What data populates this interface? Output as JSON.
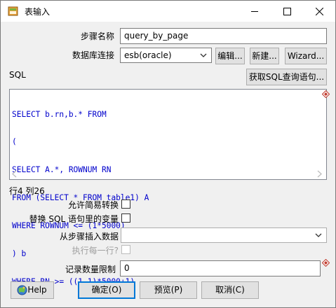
{
  "window": {
    "title": "表输入"
  },
  "form": {
    "step_name_label": "步骤名称",
    "step_name_value": "query_by_page",
    "db_connection_label": "数据库连接",
    "db_connection_value": "esb(oracle)",
    "edit_button": "编辑...",
    "new_button": "新建...",
    "wizard_button": "Wizard...",
    "sql_label": "SQL",
    "get_sql_button": "获取SQL查询语句...",
    "sql_lines": [
      "SELECT b.rn,b.* FROM",
      "(",
      "SELECT A.*, ROWNUM RN",
      "FROM (SELECT * FROM table1) A",
      "WHERE ROWNUM <= (1*5000)",
      ") b",
      "WHERE RN >= ((1-1)*5000+1)"
    ],
    "cursor_position": "行4 列26",
    "lazy_conversion_label": "允许简易转换",
    "replace_vars_label": "替换 SQL 语句里的变量",
    "insert_from_step_label": "从步骤插入数据",
    "insert_from_step_value": "",
    "execute_each_row_label": "执行每一行?",
    "limit_label": "记录数量限制",
    "limit_value": "0"
  },
  "buttons": {
    "help": "Help",
    "ok": "确定(O)",
    "preview": "预览(P)",
    "cancel": "取消(C)"
  },
  "colors": {
    "sql_text": "#0000cc",
    "primary_border": "#0078d7",
    "disabled_text": "#a0a0a0"
  }
}
